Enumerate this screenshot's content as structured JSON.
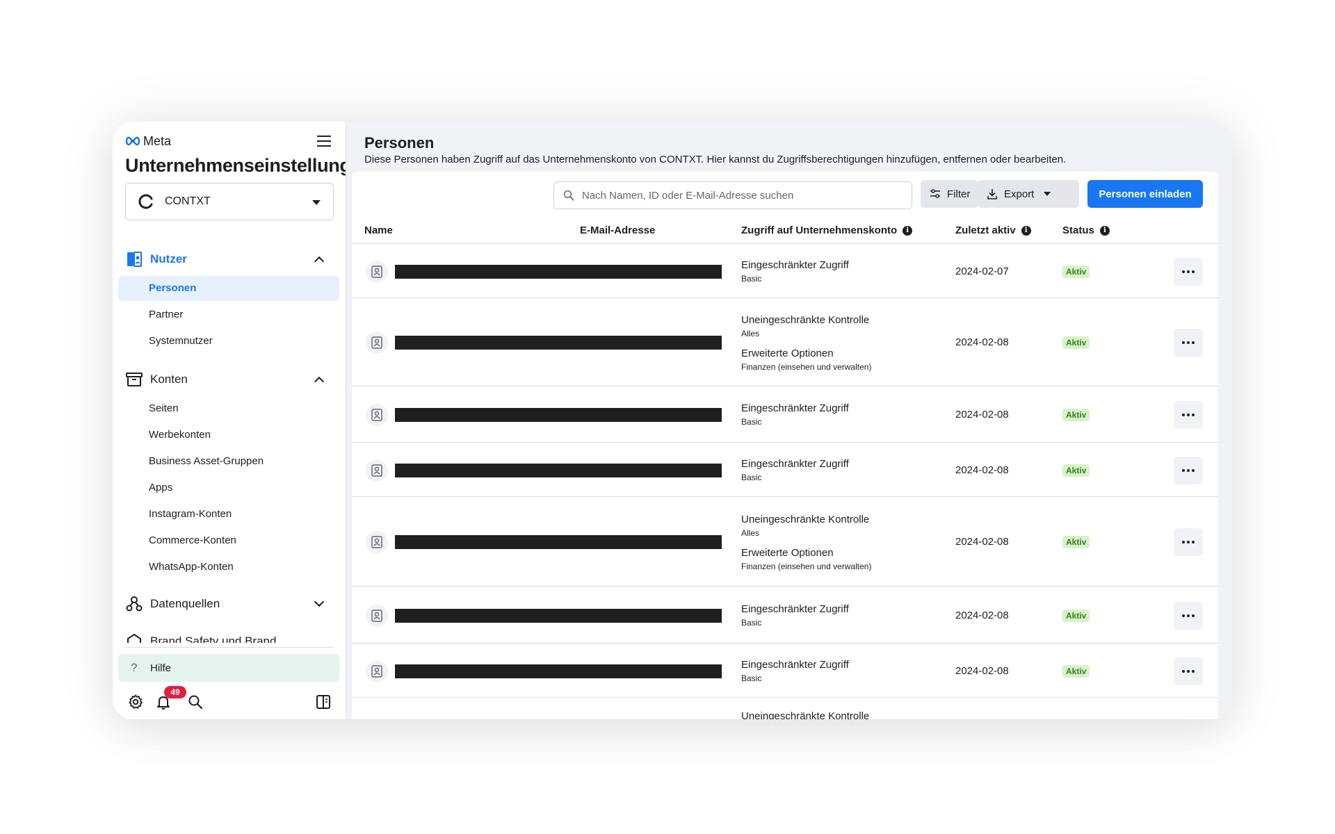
{
  "sidebar": {
    "brand": "Meta",
    "title": "Unternehmenseinstellungen",
    "account": "CONTXT",
    "sections": {
      "nutzer": {
        "label": "Nutzer",
        "items": [
          "Personen",
          "Partner",
          "Systemnutzer"
        ]
      },
      "konten": {
        "label": "Konten",
        "items": [
          "Seiten",
          "Werbekonten",
          "Business Asset-Gruppen",
          "Apps",
          "Instagram-Konten",
          "Commerce-Konten",
          "WhatsApp-Konten"
        ]
      },
      "datenquellen": {
        "label": "Datenquellen"
      },
      "brand_safety": {
        "label": "Brand Safety und Brand"
      }
    },
    "help": "Hilfe",
    "notification_count": "49"
  },
  "main": {
    "title": "Personen",
    "subtitle": "Diese Personen haben Zugriff auf das Unternehmenskonto von CONTXT. Hier kannst du Zugriffsberechtigungen hinzufügen, entfernen oder bearbeiten.",
    "search_placeholder": "Nach Namen, ID oder E-Mail-Adresse suchen",
    "filter_label": "Filter",
    "export_label": "Export",
    "invite_label": "Personen einladen",
    "columns": {
      "name": "Name",
      "email": "E-Mail-Adresse",
      "access": "Zugriff auf Unternehmenskonto",
      "last_active": "Zuletzt aktiv",
      "status": "Status"
    },
    "rows": [
      {
        "access": [
          {
            "title": "Eingeschränkter Zugriff",
            "sub": "Basic"
          }
        ],
        "date": "2024-02-07",
        "status": "Aktiv"
      },
      {
        "access": [
          {
            "title": "Uneingeschränkte Kontrolle",
            "sub": "Alles"
          },
          {
            "title": "Erweiterte Optionen",
            "sub": "Finanzen (einsehen und verwalten)"
          }
        ],
        "date": "2024-02-08",
        "status": "Aktiv"
      },
      {
        "access": [
          {
            "title": "Eingeschränkter Zugriff",
            "sub": "Basic"
          }
        ],
        "date": "2024-02-08",
        "status": "Aktiv"
      },
      {
        "access": [
          {
            "title": "Eingeschränkter Zugriff",
            "sub": "Basic"
          }
        ],
        "date": "2024-02-08",
        "status": "Aktiv"
      },
      {
        "access": [
          {
            "title": "Uneingeschränkte Kontrolle",
            "sub": "Alles"
          },
          {
            "title": "Erweiterte Optionen",
            "sub": "Finanzen (einsehen und verwalten)"
          }
        ],
        "date": "2024-02-08",
        "status": "Aktiv"
      },
      {
        "access": [
          {
            "title": "Eingeschränkter Zugriff",
            "sub": "Basic"
          }
        ],
        "date": "2024-02-08",
        "status": "Aktiv"
      },
      {
        "access": [
          {
            "title": "Eingeschränkter Zugriff",
            "sub": "Basic"
          }
        ],
        "date": "2024-02-08",
        "status": "Aktiv"
      },
      {
        "access": [
          {
            "title": "Uneingeschränkte Kontrolle",
            "sub": ""
          }
        ],
        "date": "",
        "status": ""
      }
    ]
  },
  "colors": {
    "accent": "#1877f2",
    "status_bg": "#d7f2c9",
    "status_text": "#3a7d1e",
    "badge": "#e41e3f"
  }
}
